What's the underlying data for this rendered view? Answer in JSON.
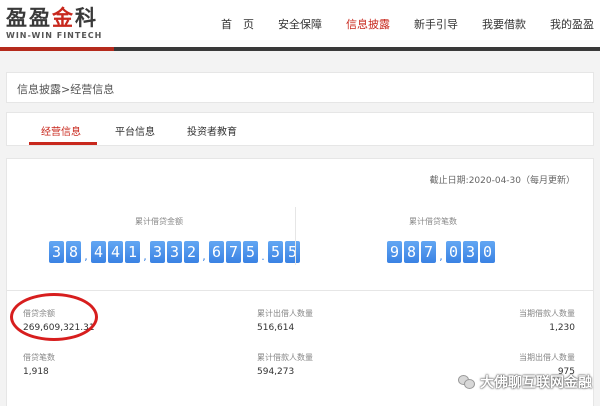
{
  "brand": {
    "logo_main_a": "盈盈",
    "logo_main_b": "金",
    "logo_main_c": "科",
    "logo_sub": "WIN-WIN FINTECH"
  },
  "nav": {
    "items": [
      {
        "label": "首　页"
      },
      {
        "label": "安全保障"
      },
      {
        "label": "信息披露"
      },
      {
        "label": "新手引导"
      },
      {
        "label": "我要借款"
      },
      {
        "label": "我的盈盈"
      }
    ],
    "active": "信息披露"
  },
  "breadcrumb": "信息披露>经营信息",
  "tabs": [
    {
      "label": "经营信息"
    },
    {
      "label": "平台信息"
    },
    {
      "label": "投资者教育"
    }
  ],
  "cutoff": "截止日期:2020-04-30（每月更新）",
  "cumulative_amount": {
    "title": "累计借贷金额",
    "value": "38,441,332,675.55"
  },
  "cumulative_count": {
    "title": "累计借贷笔数",
    "value": "987,030"
  },
  "stats": [
    {
      "label": "借贷余额",
      "value": "269,609,321.31"
    },
    {
      "label": "累计出借人数量",
      "value": "516,614"
    },
    {
      "label": "当期借款人数量",
      "value": "1,230"
    },
    {
      "label": "借贷笔数",
      "value": "1,918"
    },
    {
      "label": "累计借款人数量",
      "value": "594,273"
    },
    {
      "label": "当期出借人数量",
      "value": "975"
    }
  ],
  "watermark": "大佛聊互联网金融",
  "colors": {
    "accent": "#c8281d",
    "digit": "#3a82e3",
    "circle": "#d71e1e"
  }
}
